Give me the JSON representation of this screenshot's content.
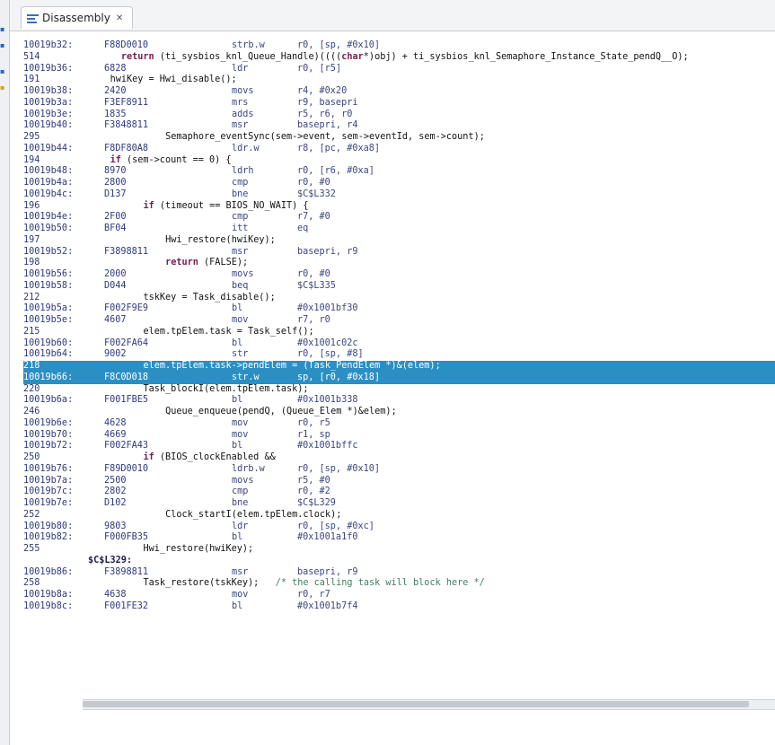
{
  "tab": {
    "label": "Disassembly",
    "close": "✕"
  },
  "partial_top": "                                          ",
  "lines": [
    {
      "type": "asm",
      "addr": "10019b32:",
      "opcode": "F88D0010",
      "mnem": "strb.w",
      "ops": "r0, [sp, #0x10]"
    },
    {
      "type": "src",
      "num": "514",
      "indent": 6,
      "parts": [
        {
          "k": "kw",
          "t": "return"
        },
        {
          "t": " (ti_sysbios_knl_Queue_Handle)(((("
        },
        {
          "k": "kw",
          "t": "char"
        },
        {
          "t": "*)obj) + ti_sysbios_knl_Semaphore_Instance_State_pendQ__O);"
        }
      ]
    },
    {
      "type": "asm",
      "addr": "10019b36:",
      "opcode": "6828",
      "mnem": "ldr",
      "ops": "r0, [r5]"
    },
    {
      "type": "src",
      "num": "191",
      "indent": 4,
      "parts": [
        {
          "t": "hwiKey = Hwi_disable();"
        }
      ]
    },
    {
      "type": "asm",
      "addr": "10019b38:",
      "opcode": "2420",
      "mnem": "movs",
      "ops": "r4, #0x20"
    },
    {
      "type": "asm",
      "addr": "10019b3a:",
      "opcode": "F3EF8911",
      "mnem": "mrs",
      "ops": "r9, basepri"
    },
    {
      "type": "asm",
      "addr": "10019b3e:",
      "opcode": "1835",
      "mnem": "adds",
      "ops": "r5, r6, r0"
    },
    {
      "type": "asm",
      "addr": "10019b40:",
      "opcode": "F3848811",
      "mnem": "msr",
      "ops": "basepri, r4"
    },
    {
      "type": "src",
      "num": "295",
      "indent": 14,
      "parts": [
        {
          "t": "Semaphore_eventSync(sem->event, sem->eventId, sem->count);"
        }
      ]
    },
    {
      "type": "asm",
      "addr": "10019b44:",
      "opcode": "F8DF80A8",
      "mnem": "ldr.w",
      "ops": "r8, [pc, #0xa8]"
    },
    {
      "type": "src",
      "num": "194",
      "indent": 4,
      "parts": [
        {
          "k": "kw",
          "t": "if"
        },
        {
          "t": " (sem->count == 0) {"
        }
      ]
    },
    {
      "type": "asm",
      "addr": "10019b48:",
      "opcode": "8970",
      "mnem": "ldrh",
      "ops": "r0, [r6, #0xa]"
    },
    {
      "type": "asm",
      "addr": "10019b4a:",
      "opcode": "2800",
      "mnem": "cmp",
      "ops": "r0, #0"
    },
    {
      "type": "asm",
      "addr": "10019b4c:",
      "opcode": "D137",
      "mnem": "bne",
      "ops": "$C$L332"
    },
    {
      "type": "src",
      "num": "196",
      "indent": 10,
      "parts": [
        {
          "k": "kw",
          "t": "if"
        },
        {
          "t": " (timeout == BIOS_NO_WAIT) {"
        }
      ]
    },
    {
      "type": "asm",
      "addr": "10019b4e:",
      "opcode": "2F00",
      "mnem": "cmp",
      "ops": "r7, #0"
    },
    {
      "type": "asm",
      "addr": "10019b50:",
      "opcode": "BF04",
      "mnem": "itt",
      "ops": "eq"
    },
    {
      "type": "src",
      "num": "197",
      "indent": 14,
      "parts": [
        {
          "t": "Hwi_restore(hwiKey);"
        }
      ]
    },
    {
      "type": "asm",
      "addr": "10019b52:",
      "opcode": "F3898811",
      "mnem": "msr",
      "ops": "basepri, r9"
    },
    {
      "type": "src",
      "num": "198",
      "indent": 14,
      "parts": [
        {
          "k": "kw",
          "t": "return"
        },
        {
          "t": " (FALSE);"
        }
      ]
    },
    {
      "type": "asm",
      "addr": "10019b56:",
      "opcode": "2000",
      "mnem": "movs",
      "ops": "r0, #0"
    },
    {
      "type": "asm",
      "addr": "10019b58:",
      "opcode": "D044",
      "mnem": "beq",
      "ops": "$C$L335"
    },
    {
      "type": "src",
      "num": "212",
      "indent": 10,
      "parts": [
        {
          "t": "tskKey = Task_disable();"
        }
      ]
    },
    {
      "type": "asm",
      "addr": "10019b5a:",
      "opcode": "F002F9E9",
      "mnem": "bl",
      "ops": "#0x1001bf30"
    },
    {
      "type": "asm",
      "addr": "10019b5e:",
      "opcode": "4607",
      "mnem": "mov",
      "ops": "r7, r0"
    },
    {
      "type": "src",
      "num": "215",
      "indent": 10,
      "parts": [
        {
          "t": "elem.tpElem.task = Task_self();"
        }
      ]
    },
    {
      "type": "asm",
      "addr": "10019b60:",
      "opcode": "F002FA64",
      "mnem": "bl",
      "ops": "#0x1001c02c"
    },
    {
      "type": "asm",
      "addr": "10019b64:",
      "opcode": "9002",
      "mnem": "str",
      "ops": "r0, [sp, #8]"
    },
    {
      "type": "src",
      "num": "218",
      "indent": 10,
      "hl": true,
      "parts": [
        {
          "t": "elem.tpElem.task->pendElem = (Task_PendElem *)&(elem);"
        }
      ]
    },
    {
      "type": "asm",
      "addr": "10019b66:",
      "opcode": "F8C0D018",
      "mnem": "str.w",
      "ops": "sp, [r0, #0x18]",
      "hl": true
    },
    {
      "type": "src",
      "num": "220",
      "indent": 10,
      "parts": [
        {
          "t": "Task_blockI(elem.tpElem.task);"
        }
      ]
    },
    {
      "type": "asm",
      "addr": "10019b6a:",
      "opcode": "F001FBE5",
      "mnem": "bl",
      "ops": "#0x1001b338"
    },
    {
      "type": "src",
      "num": "246",
      "indent": 14,
      "parts": [
        {
          "t": "Queue_enqueue(pendQ, (Queue_Elem *)&elem);"
        }
      ]
    },
    {
      "type": "asm",
      "addr": "10019b6e:",
      "opcode": "4628",
      "mnem": "mov",
      "ops": "r0, r5"
    },
    {
      "type": "asm",
      "addr": "10019b70:",
      "opcode": "4669",
      "mnem": "mov",
      "ops": "r1, sp"
    },
    {
      "type": "asm",
      "addr": "10019b72:",
      "opcode": "F002FA43",
      "mnem": "bl",
      "ops": "#0x1001bffc"
    },
    {
      "type": "src",
      "num": "250",
      "indent": 10,
      "parts": [
        {
          "k": "kw",
          "t": "if"
        },
        {
          "t": " (BIOS_clockEnabled &&"
        }
      ]
    },
    {
      "type": "asm",
      "addr": "10019b76:",
      "opcode": "F89D0010",
      "mnem": "ldrb.w",
      "ops": "r0, [sp, #0x10]"
    },
    {
      "type": "asm",
      "addr": "10019b7a:",
      "opcode": "2500",
      "mnem": "movs",
      "ops": "r5, #0"
    },
    {
      "type": "asm",
      "addr": "10019b7c:",
      "opcode": "2802",
      "mnem": "cmp",
      "ops": "r0, #2"
    },
    {
      "type": "asm",
      "addr": "10019b7e:",
      "opcode": "D102",
      "mnem": "bne",
      "ops": "$C$L329"
    },
    {
      "type": "src",
      "num": "252",
      "indent": 14,
      "parts": [
        {
          "t": "Clock_startI(elem.tpElem.clock);"
        }
      ]
    },
    {
      "type": "asm",
      "addr": "10019b80:",
      "opcode": "9803",
      "mnem": "ldr",
      "ops": "r0, [sp, #0xc]"
    },
    {
      "type": "asm",
      "addr": "10019b82:",
      "opcode": "F000FB35",
      "mnem": "bl",
      "ops": "#0x1001a1f0"
    },
    {
      "type": "src",
      "num": "255",
      "indent": 10,
      "parts": [
        {
          "t": "Hwi_restore(hwiKey);"
        }
      ]
    },
    {
      "type": "label",
      "text": "$C$L329:"
    },
    {
      "type": "asm",
      "addr": "10019b86:",
      "opcode": "F3898811",
      "mnem": "msr",
      "ops": "basepri, r9"
    },
    {
      "type": "src",
      "num": "258",
      "indent": 10,
      "parts": [
        {
          "t": "Task_restore(tskKey);   "
        },
        {
          "k": "cm",
          "t": "/* the calling task will block here */"
        }
      ]
    },
    {
      "type": "asm",
      "addr": "10019b8a:",
      "opcode": "4638",
      "mnem": "mov",
      "ops": "r0, r7"
    },
    {
      "type": "asm",
      "addr": "10019b8c:",
      "opcode": "F001FE32",
      "mnem": "bl",
      "ops": "#0x1001b7f4"
    }
  ]
}
